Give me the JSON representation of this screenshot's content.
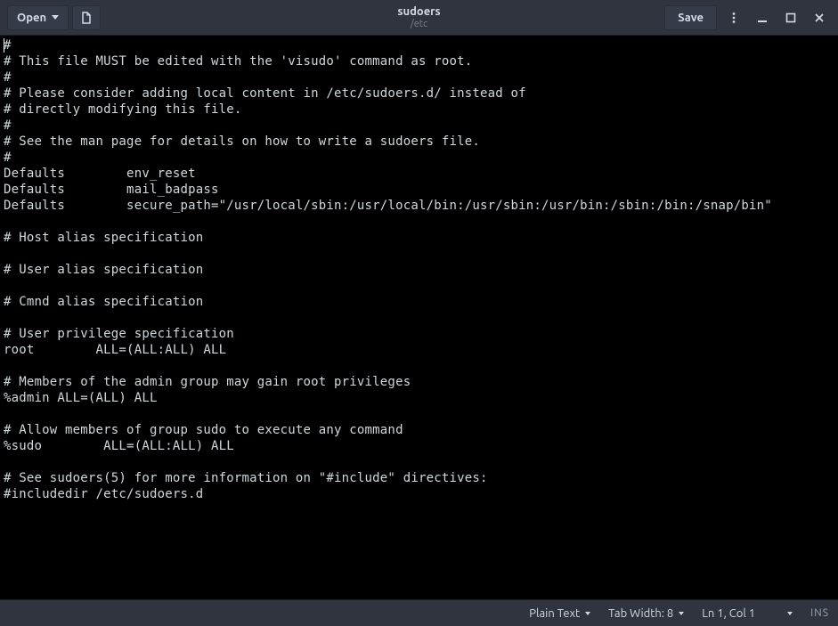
{
  "titlebar": {
    "open_label": "Open",
    "save_label": "Save",
    "filename": "sudoers",
    "directory": "/etc"
  },
  "editor": {
    "content": "#\n# This file MUST be edited with the 'visudo' command as root.\n#\n# Please consider adding local content in /etc/sudoers.d/ instead of\n# directly modifying this file.\n#\n# See the man page for details on how to write a sudoers file.\n#\nDefaults\tenv_reset\nDefaults\tmail_badpass\nDefaults\tsecure_path=\"/usr/local/sbin:/usr/local/bin:/usr/sbin:/usr/bin:/sbin:/bin:/snap/bin\"\n\n# Host alias specification\n\n# User alias specification\n\n# Cmnd alias specification\n\n# User privilege specification\nroot\tALL=(ALL:ALL) ALL\n\n# Members of the admin group may gain root privileges\n%admin ALL=(ALL) ALL\n\n# Allow members of group sudo to execute any command\n%sudo\tALL=(ALL:ALL) ALL\n\n# See sudoers(5) for more information on \"#include\" directives:\n#includedir /etc/sudoers.d"
  },
  "statusbar": {
    "syntax": "Plain Text",
    "tab_width_label": "Tab Width: 8",
    "position": "Ln 1, Col 1",
    "insert_mode": "INS"
  }
}
